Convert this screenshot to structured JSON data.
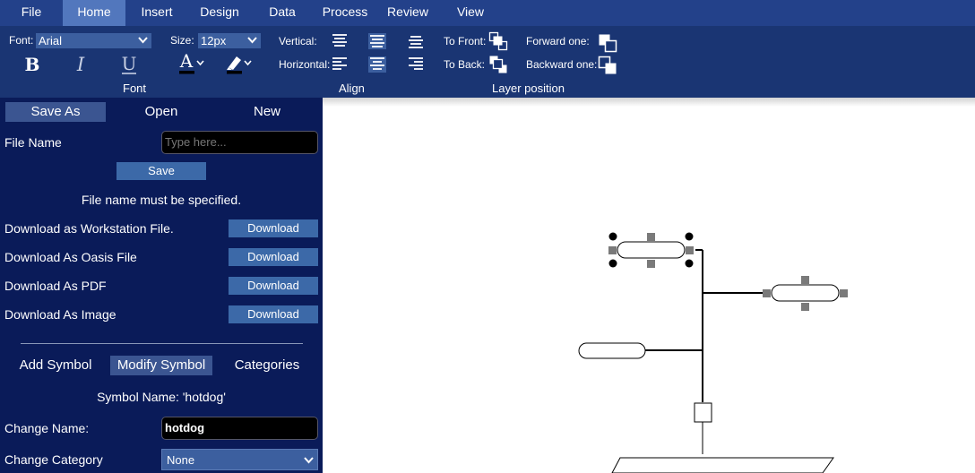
{
  "menu": {
    "items": [
      {
        "label": "File",
        "active": false
      },
      {
        "label": "Home",
        "active": true
      },
      {
        "label": "Insert",
        "active": false
      },
      {
        "label": "Design",
        "active": false
      },
      {
        "label": "Data",
        "active": false
      },
      {
        "label": "Process",
        "active": false
      },
      {
        "label": "Review",
        "active": false
      },
      {
        "label": "View",
        "active": false
      }
    ]
  },
  "ribbon": {
    "font_label": "Font:",
    "font_value": "Arial",
    "size_label": "Size:",
    "size_value": "12px",
    "font_group_title": "Font",
    "vertical_label": "Vertical:",
    "horizontal_label": "Horizontal:",
    "align_group_title": "Align",
    "to_front_label": "To Front:",
    "to_back_label": "To Back:",
    "forward_one_label": "Forward one:",
    "backward_one_label": "Backward one:",
    "layer_group_title": "Layer position",
    "bold_glyph": "B",
    "italic_glyph": "I",
    "underline_glyph": "U",
    "font_color_glyph": "A"
  },
  "sidebar": {
    "file_tabs": [
      {
        "label": "Save As",
        "active": true
      },
      {
        "label": "Open",
        "active": false
      },
      {
        "label": "New",
        "active": false
      }
    ],
    "file_name_label": "File Name",
    "file_name_placeholder": "Type here...",
    "save_button": "Save",
    "error_message": "File name must be specified.",
    "downloads": [
      {
        "label": "Download as Workstation File.",
        "button": "Download"
      },
      {
        "label": "Download As Oasis File",
        "button": "Download"
      },
      {
        "label": "Download As PDF",
        "button": "Download"
      },
      {
        "label": "Download As Image",
        "button": "Download"
      }
    ],
    "symbol_tabs": [
      {
        "label": "Add Symbol",
        "active": false
      },
      {
        "label": "Modify Symbol",
        "active": true
      },
      {
        "label": "Categories",
        "active": false
      }
    ],
    "symbol_name_text": "Symbol Name: 'hotdog'",
    "change_name_label": "Change Name:",
    "change_name_value": "hotdog",
    "change_category_label": "Change Category",
    "change_category_value": "None"
  },
  "colors": {
    "menubar_bg": "#23418a",
    "menu_active_bg": "#5277bd",
    "ribbon_bg": "#1a3573",
    "sidebar_bg": "#0a1b59",
    "button_bg": "#3c69a8",
    "handle_grey": "#7a7a7a"
  },
  "icons": [
    "chevron-down-icon",
    "bold-icon",
    "italic-icon",
    "underline-icon",
    "font-color-icon",
    "highlight-icon",
    "align-top-icon",
    "align-middle-icon",
    "align-bottom-icon",
    "align-left-icon",
    "align-center-icon",
    "align-right-icon",
    "bring-to-front-icon",
    "send-to-back-icon",
    "bring-forward-icon",
    "send-backward-icon"
  ]
}
